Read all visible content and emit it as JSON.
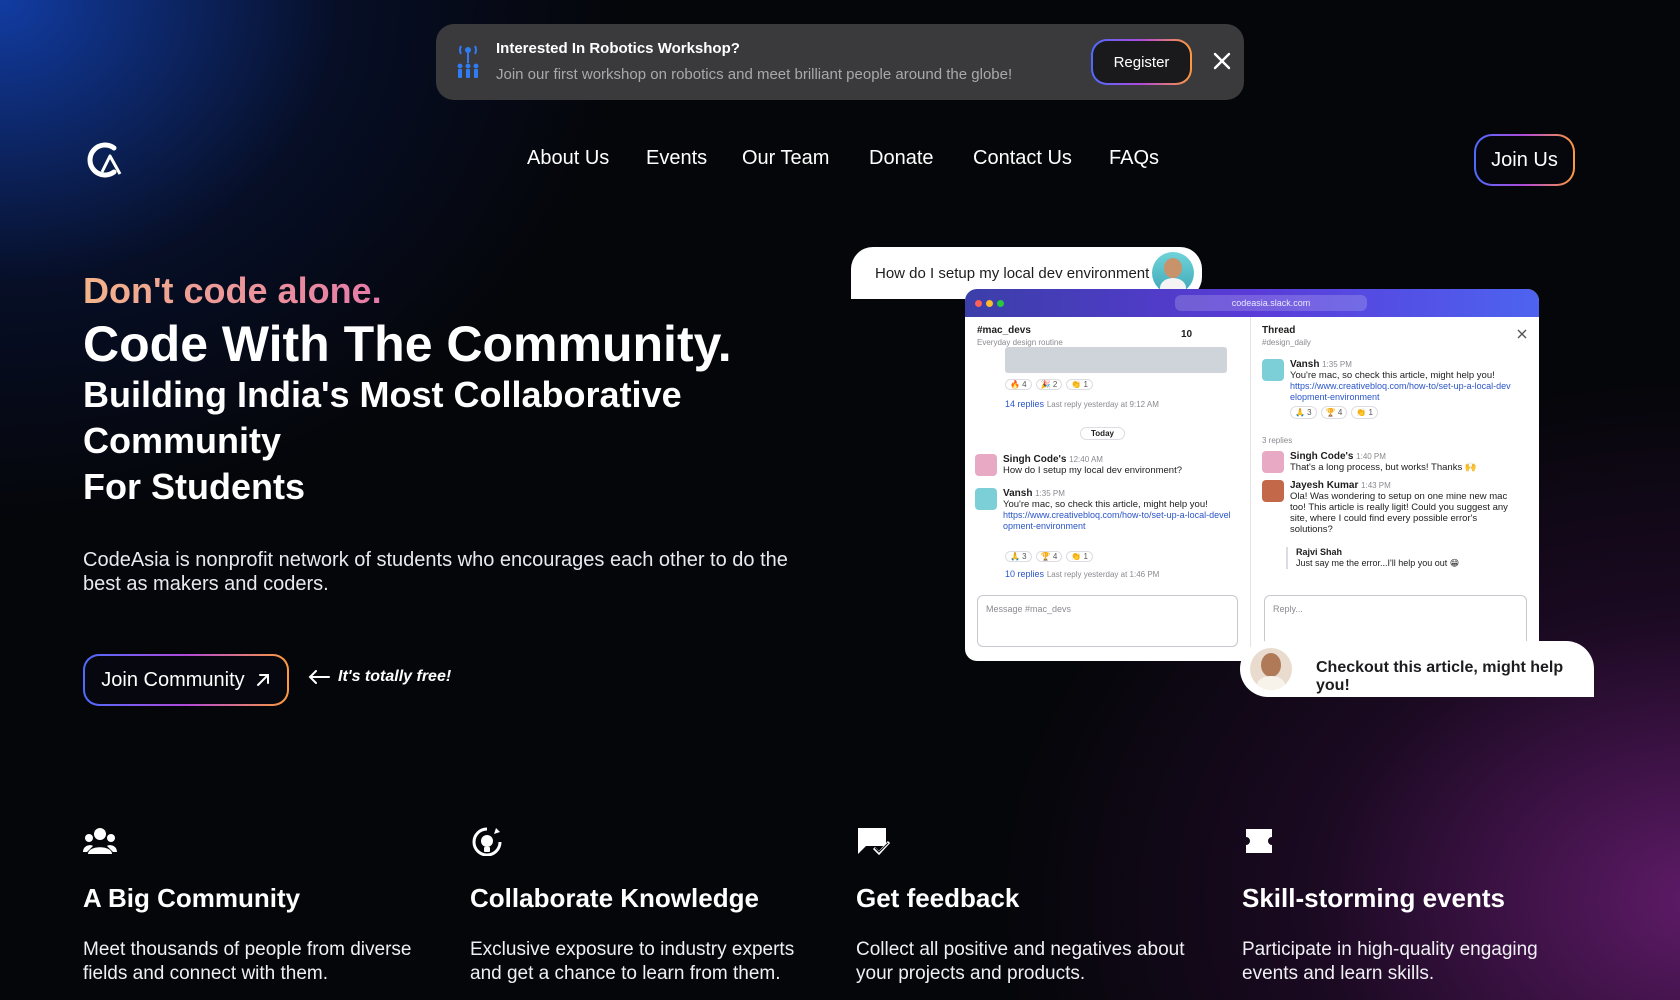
{
  "banner": {
    "title": "Interested In Robotics Workshop?",
    "subtitle": "Join our first workshop on robotics and meet brilliant people around the globe!",
    "register_label": "Register"
  },
  "nav": {
    "items": [
      "About Us",
      "Events",
      "Our Team",
      "Donate",
      "Contact Us",
      "FAQs"
    ],
    "join_label": "Join Us"
  },
  "hero": {
    "tagline": "Don't code alone.",
    "title": "Code With The Community.",
    "subtitle_line1": "Building India's Most Collaborative",
    "subtitle_line2": "Community",
    "subtitle_line3": "For Students",
    "description": "CodeAsia is nonprofit network of students who encourages each other to do the best as makers and coders.",
    "cta_label": "Join Community",
    "free_note": "It's totally free!"
  },
  "mockup": {
    "question_bubble": "How do I setup my local dev environment",
    "answer_bubble": "Checkout this article, might help you!",
    "url": "codeasia.slack.com",
    "channel": "#mac_devs",
    "channel_sub": "Everyday design routine",
    "member_count": "10",
    "today_label": "Today",
    "replies_a": "14 replies",
    "replies_a_meta": "Last reply yesterday at 9:12 AM",
    "msg1_user": "Singh Code's",
    "msg1_time": "12:40 AM",
    "msg1_text": "How do I setup my local dev environment?",
    "msg2_user": "Vansh",
    "msg2_time": "1:35 PM",
    "msg2_text": "You're mac, so check this article, might help you!",
    "msg2_link": "https://www.creativebloq.com/how-to/set-up-a-local-development-environment",
    "replies_b": "10 replies",
    "replies_b_meta": "Last reply yesterday at 1:46 PM",
    "compose_placeholder": "Message #mac_devs",
    "thread_title": "Thread",
    "thread_sub": "#design_daily",
    "thread_msg1_user": "Vansh",
    "thread_msg1_time": "1:35 PM",
    "thread_msg1_text": "You're mac, so check this article, might help you!",
    "thread_msg1_link": "https://www.creativebloq.com/how-to/set-up-a-local-development-environment",
    "replies_count": "3 replies",
    "thread_msg2_user": "Singh Code's",
    "thread_msg2_time": "1:40 PM",
    "thread_msg2_text": "That's a long process, but works! Thanks 🙌",
    "thread_msg3_user": "Jayesh Kumar",
    "thread_msg3_time": "1:43 PM",
    "thread_msg3_text": "Ola! Was wondering to setup on one mine new mac too! This article is really ligit! Could you suggest any site, where I could find every possible error's solutions?",
    "thread_msg4_user": "Rajvi Shah",
    "thread_msg4_text": "Just say me the error...I'll help you out 😁",
    "reply_placeholder": "Reply..."
  },
  "features": [
    {
      "icon": "community-icon",
      "title": "A Big Community",
      "desc": "Meet thousands of people from diverse fields and connect with them."
    },
    {
      "icon": "lightbulb-icon",
      "title": "Collaborate Knowledge",
      "desc": "Exclusive exposure to industry experts and get a chance to learn from them."
    },
    {
      "icon": "feedback-icon",
      "title": "Get feedback",
      "desc": "Collect all positive and negatives about your projects and products."
    },
    {
      "icon": "ticket-icon",
      "title": "Skill-storming events",
      "desc": "Participate in high-quality engaging events and learn skills."
    }
  ]
}
